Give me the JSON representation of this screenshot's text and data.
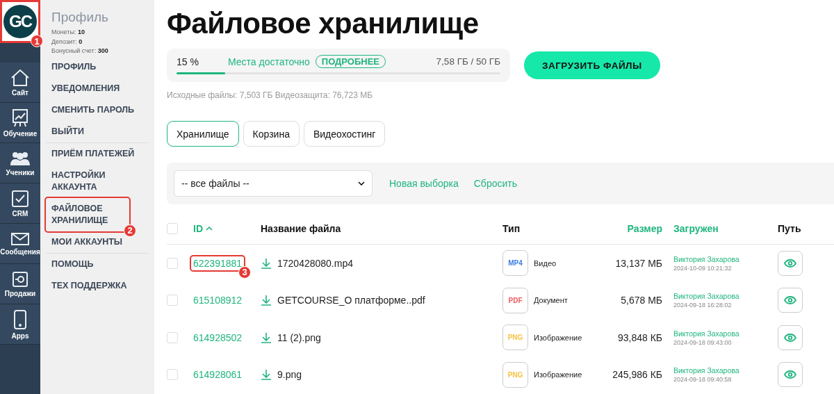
{
  "rail": {
    "logo": {
      "text": "GC",
      "callout": "1"
    },
    "items": [
      {
        "label": "Сайт"
      },
      {
        "label": "Обучение"
      },
      {
        "label": "Ученики"
      },
      {
        "label": "CRM"
      },
      {
        "label": "Сообщения"
      },
      {
        "label": "Продажи"
      },
      {
        "label": "Apps"
      }
    ]
  },
  "menu": {
    "title": "Профиль",
    "stats": [
      {
        "label": "Монеты:",
        "value": "10"
      },
      {
        "label": "Депозит:",
        "value": "0"
      },
      {
        "label": "Бонусный счет:",
        "value": "300"
      }
    ],
    "groups": [
      [
        {
          "label": "ПРОФИЛЬ"
        },
        {
          "label": "УВЕДОМЛЕНИЯ"
        },
        {
          "label": "СМЕНИТЬ ПАРОЛЬ"
        },
        {
          "label": "ВЫЙТИ"
        }
      ],
      [
        {
          "label": "ПРИЁМ ПЛАТЕЖЕЙ"
        },
        {
          "label": "НАСТРОЙКИ АККАУНТА"
        },
        {
          "label": "ФАЙЛОВОЕ ХРАНИЛИЩЕ",
          "callout": "2"
        },
        {
          "label": "МОИ АККАУНТЫ"
        }
      ],
      [
        {
          "label": "ПОМОЩЬ"
        },
        {
          "label": "ТЕХ ПОДДЕРЖКА"
        }
      ]
    ]
  },
  "page": {
    "title": "Файловое хранилище",
    "storage": {
      "percent": "15 %",
      "status": "Места достаточно",
      "more": "ПОДРОБНЕЕ",
      "usage": "7,58 ГБ / 50 ГБ",
      "level": 0.15
    },
    "upload_button": "ЗАГРУЗИТЬ ФАЙЛЫ",
    "info": "Исходные файлы: 7,503 ГБ Видеозащита: 76,723 МБ",
    "tabs": [
      {
        "label": "Хранилище",
        "selected": true
      },
      {
        "label": "Корзина",
        "selected": false
      },
      {
        "label": "Видеохостинг",
        "selected": false
      }
    ],
    "filter": {
      "select": "-- все файлы --",
      "links": [
        "Новая выборка",
        "Сбросить"
      ]
    },
    "table": {
      "select_all": {
        "checked": false
      },
      "columns": [
        {
          "label": "ID",
          "sortable": true,
          "sorted": true
        },
        {
          "label": "Название файла",
          "sortable": false
        },
        {
          "label": "Тип",
          "sortable": false
        },
        {
          "label": "Размер",
          "sortable": true
        },
        {
          "label": "Загружен",
          "sortable": true
        },
        {
          "label": "Путь",
          "sortable": false
        }
      ],
      "rows": [
        {
          "checked": false,
          "id": "622391881",
          "callout": "3",
          "name": "1720428080.mp4",
          "badge": "MP4",
          "color": "#3b7be0",
          "type": "Видео",
          "size": "13,137 МБ",
          "uploader": "Виктория Захарова",
          "date": "2024-10-09 10:21:32"
        },
        {
          "checked": false,
          "id": "615108912",
          "name": "GETCOURSE_О платформе..pdf",
          "badge": "PDF",
          "color": "#f0595c",
          "type": "Документ",
          "size": "5,678 МБ",
          "uploader": "Виктория Захарова",
          "date": "2024-09-18 16:28:02"
        },
        {
          "checked": false,
          "id": "614928502",
          "name": "11 (2).png",
          "badge": "PNG",
          "color": "#f7c040",
          "type": "Изображение",
          "size": "93,848 КБ",
          "uploader": "Виктория Захарова",
          "date": "2024-09-18 09:43:00"
        },
        {
          "checked": false,
          "id": "614928061",
          "name": "9.png",
          "badge": "PNG",
          "color": "#f7c040",
          "type": "Изображение",
          "size": "245,986 КБ",
          "uploader": "Виктория Захарова",
          "date": "2024-09-18 09:40:58"
        }
      ]
    }
  }
}
